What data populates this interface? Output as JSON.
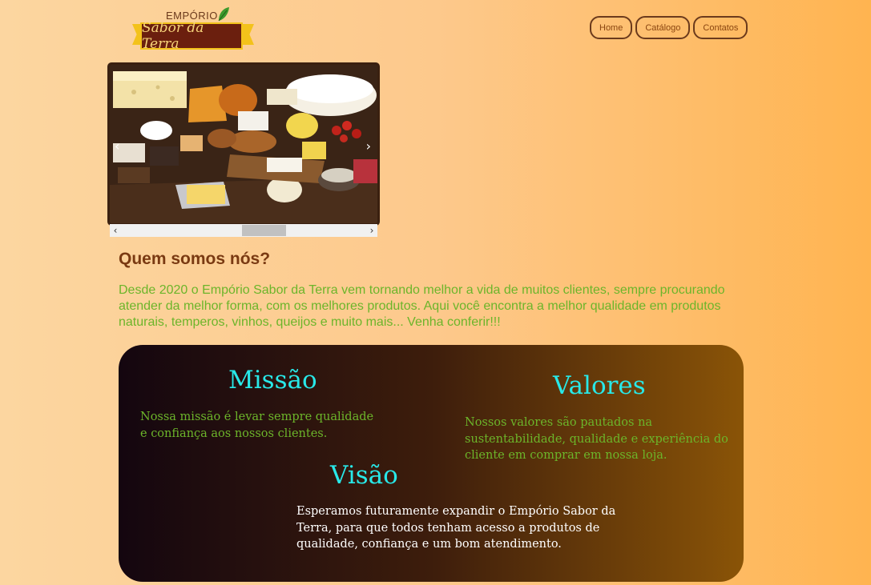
{
  "logo": {
    "top_text": "EMPÓRIO",
    "banner_text": "Sabor da Terra"
  },
  "nav": {
    "items": [
      "Home",
      "Catálogo",
      "Contatos"
    ]
  },
  "carousel": {
    "prev_label": "‹",
    "next_label": "›"
  },
  "scrollbar": {
    "left_label": "‹",
    "right_label": "›"
  },
  "about": {
    "title": "Quem somos nós?",
    "text": "Desde 2020 o Empório Sabor da Terra vem tornando melhor a vida de muitos clientes, sempre procurando atender da melhor forma, com os melhores produtos. Aqui você encontra a melhor qualidade em produtos naturais, temperos, vinhos, queijos e muito mais... Venha conferir!!!"
  },
  "missao": {
    "title": "Missão",
    "text": "Nossa missão é levar sempre qualidade e confiança aos nossos clientes."
  },
  "valores": {
    "title": "Valores",
    "text": "Nossos valores são pautados na sustentabilidade, qualidade e experiência do cliente em comprar em nossa loja."
  },
  "visao": {
    "title": "Visão",
    "text": "Esperamos futuramente expandir o Empório Sabor da Terra, para que todos tenham acesso a produtos de qualidade, confiança e um bom atendimento."
  },
  "colors": {
    "title_cyan": "#28e8e8",
    "green_text": "#6cb52a",
    "brown_title": "#7a3a12",
    "accent_yellow": "#f3c21b"
  }
}
